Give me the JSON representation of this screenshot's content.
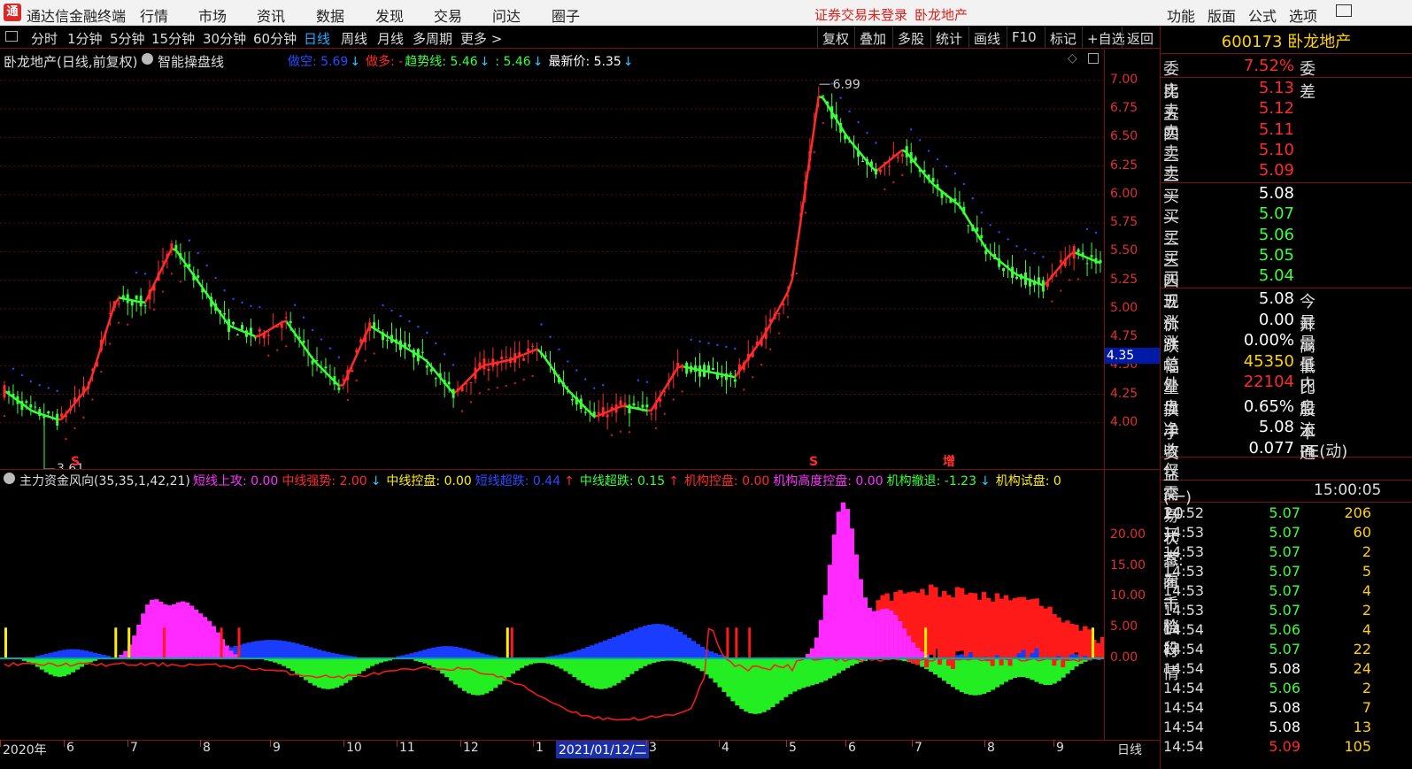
{
  "app": {
    "logo": "通",
    "title": "通达信金融终端",
    "menu": [
      "行情",
      "市场",
      "资讯",
      "数据",
      "发现",
      "交易",
      "问达",
      "圈子"
    ],
    "warning": "证券交易未登录",
    "stock_short": "卧龙地产",
    "right_menu": [
      "功能",
      "版面",
      "公式",
      "选项"
    ]
  },
  "periods": [
    "分时",
    "1分钟",
    "5分钟",
    "15分钟",
    "30分钟",
    "60分钟",
    "日线",
    "周线",
    "月线",
    "多周期",
    "更多 >"
  ],
  "active_period": "日线",
  "toolbar_buttons": [
    "复权",
    "叠加",
    "多股",
    "统计",
    "画线",
    "F10",
    "标记",
    "+自选",
    "返回"
  ],
  "main_chart": {
    "title": "卧龙地产(日线,前复权)",
    "indicator": "智能操盘线",
    "legend": [
      {
        "text": "做空: 5.69",
        "color": "#2a4bff"
      },
      {
        "text": "↓",
        "color": "#2fc7ff"
      },
      {
        "text": "做多: -",
        "color": "#ff2a2a"
      },
      {
        "text": "趋势线: 5.46",
        "color": "#3aff3a"
      },
      {
        "text": "↓",
        "color": "#2fc7ff"
      },
      {
        "text": ": 5.46",
        "color": "#3aff3a"
      },
      {
        "text": "↓",
        "color": "#2fc7ff"
      },
      {
        "text": "最新价: 5.35",
        "color": "#ffffff"
      },
      {
        "text": "↓",
        "color": "#2fc7ff"
      }
    ],
    "yticks": [
      "7.00",
      "6.75",
      "6.50",
      "6.25",
      "6.00",
      "5.75",
      "5.50",
      "5.25",
      "5.00",
      "4.75",
      "4.50",
      "4.25",
      "4.00"
    ],
    "cursor_value": "4.35",
    "annotations": {
      "high": "6.99",
      "low": "3.61",
      "s1": "S",
      "s2": "S",
      "zeng": "增"
    }
  },
  "sub_chart": {
    "title": "主力资金风向(35,35,1,42,21)",
    "legend": [
      {
        "text": "短线上攻: 0.00",
        "color": "#ff30ff"
      },
      {
        "text": "中线强势: 2.00",
        "color": "#ff2a2a"
      },
      {
        "text": "↓",
        "color": "#2fc7ff"
      },
      {
        "text": "中线控盘: 0.00",
        "color": "#ffee00"
      },
      {
        "text": "短线超跌: 0.44",
        "color": "#2a4bff"
      },
      {
        "text": "↑",
        "color": "#ff2a2a"
      },
      {
        "text": "中线超跌: 0.15",
        "color": "#3aff3a"
      },
      {
        "text": "↑",
        "color": "#ff2a2a"
      },
      {
        "text": "机构控盘: 0.00",
        "color": "#ff2a2a"
      },
      {
        "text": "机构高度控盘: 0.00",
        "color": "#ff30ff"
      },
      {
        "text": "机构撤退: -1.23",
        "color": "#3aff3a"
      },
      {
        "text": "↓",
        "color": "#2fc7ff"
      },
      {
        "text": "机构试盘: 0",
        "color": "#ffee00"
      }
    ],
    "yticks": [
      "20.00",
      "15.00",
      "10.00",
      "5.00",
      "0.00"
    ]
  },
  "xaxis": {
    "labels": [
      "2020年",
      "6",
      "7",
      "8",
      "9",
      "10",
      "11",
      "12",
      "1",
      "2021/01/12/二",
      "3",
      "4",
      "5",
      "6",
      "7",
      "8",
      "9"
    ],
    "period": "日线"
  },
  "quote": {
    "header": "600173 卧龙地产",
    "weibi": {
      "label": "委比",
      "value": "7.52%",
      "label2": "委差"
    },
    "sells": [
      {
        "label": "卖五",
        "price": "5.13"
      },
      {
        "label": "卖四",
        "price": "5.12"
      },
      {
        "label": "卖三",
        "price": "5.11"
      },
      {
        "label": "卖二",
        "price": "5.10"
      },
      {
        "label": "卖一",
        "price": "5.09"
      }
    ],
    "buys": [
      {
        "label": "买一",
        "price": "5.08"
      },
      {
        "label": "买二",
        "price": "5.07"
      },
      {
        "label": "买三",
        "price": "5.06"
      },
      {
        "label": "买四",
        "price": "5.05"
      },
      {
        "label": "买五",
        "price": "5.04"
      }
    ],
    "stats": [
      {
        "label": "现价",
        "value": "5.08",
        "color": "#ffffff",
        "label2": "今开"
      },
      {
        "label": "涨跌",
        "value": "0.00",
        "color": "#ffffff",
        "label2": "最高"
      },
      {
        "label": "涨幅",
        "value": "0.00%",
        "color": "#ffffff",
        "label2": "最低"
      },
      {
        "label": "总量",
        "value": "45350",
        "color": "#ffd200",
        "label2": "量比"
      },
      {
        "label": "外盘",
        "value": "22104",
        "color": "#ff2a2a",
        "label2": "内盘"
      },
      {
        "label": "换手",
        "value": "0.65%",
        "color": "#ffffff",
        "label2": "股本"
      },
      {
        "label": "净资",
        "value": "5.08",
        "color": "#ffffff",
        "label2": "流通"
      },
      {
        "label": "收益(一)",
        "value": "0.077",
        "color": "#ffffff",
        "label2": "PE(动)"
      }
    ],
    "promo": "仅需20元查看千档行情",
    "trade_state": "交易状态: 闭市阶段",
    "trade_time": "15:00:05",
    "ticks": [
      {
        "t": "14:52",
        "p": "5.07",
        "q": "206",
        "c": "#3aff3a"
      },
      {
        "t": "14:53",
        "p": "5.07",
        "q": "60",
        "c": "#3aff3a"
      },
      {
        "t": "14:53",
        "p": "5.07",
        "q": "2",
        "c": "#3aff3a"
      },
      {
        "t": "14:53",
        "p": "5.07",
        "q": "5",
        "c": "#3aff3a"
      },
      {
        "t": "14:53",
        "p": "5.07",
        "q": "4",
        "c": "#3aff3a"
      },
      {
        "t": "14:53",
        "p": "5.07",
        "q": "2",
        "c": "#3aff3a"
      },
      {
        "t": "14:54",
        "p": "5.06",
        "q": "4",
        "c": "#3aff3a"
      },
      {
        "t": "14:54",
        "p": "5.07",
        "q": "22",
        "c": "#3aff3a"
      },
      {
        "t": "14:54",
        "p": "5.08",
        "q": "24",
        "c": "#ffffff"
      },
      {
        "t": "14:54",
        "p": "5.06",
        "q": "2",
        "c": "#3aff3a"
      },
      {
        "t": "14:54",
        "p": "5.08",
        "q": "7",
        "c": "#ffffff"
      },
      {
        "t": "14:54",
        "p": "5.08",
        "q": "13",
        "c": "#ffffff"
      },
      {
        "t": "14:54",
        "p": "5.09",
        "q": "105",
        "c": "#ff2a2a"
      }
    ]
  },
  "chart_data": {
    "type": "line",
    "series_name": "智能操盘线",
    "time_axis": [
      "2020年5月",
      "6",
      "7",
      "8",
      "9",
      "10",
      "11",
      "12",
      "1",
      "2021/01/12",
      "3",
      "4",
      "5",
      "6",
      "7",
      "8",
      "9"
    ],
    "trend_values": [
      4.28,
      4.1,
      4.02,
      4.32,
      5.1,
      5.05,
      5.55,
      5.2,
      4.85,
      4.75,
      4.9,
      4.55,
      4.3,
      4.85,
      4.7,
      4.55,
      4.25,
      4.5,
      4.55,
      4.65,
      4.3,
      4.05,
      4.15,
      4.1,
      4.5,
      4.45,
      4.4,
      4.75,
      5.2,
      6.9,
      6.5,
      6.2,
      6.4,
      6.1,
      5.9,
      5.5,
      5.3,
      5.2,
      5.5,
      5.4
    ],
    "price_range": [
      3.61,
      6.99
    ],
    "ylim": [
      3.75,
      7.1
    ]
  }
}
